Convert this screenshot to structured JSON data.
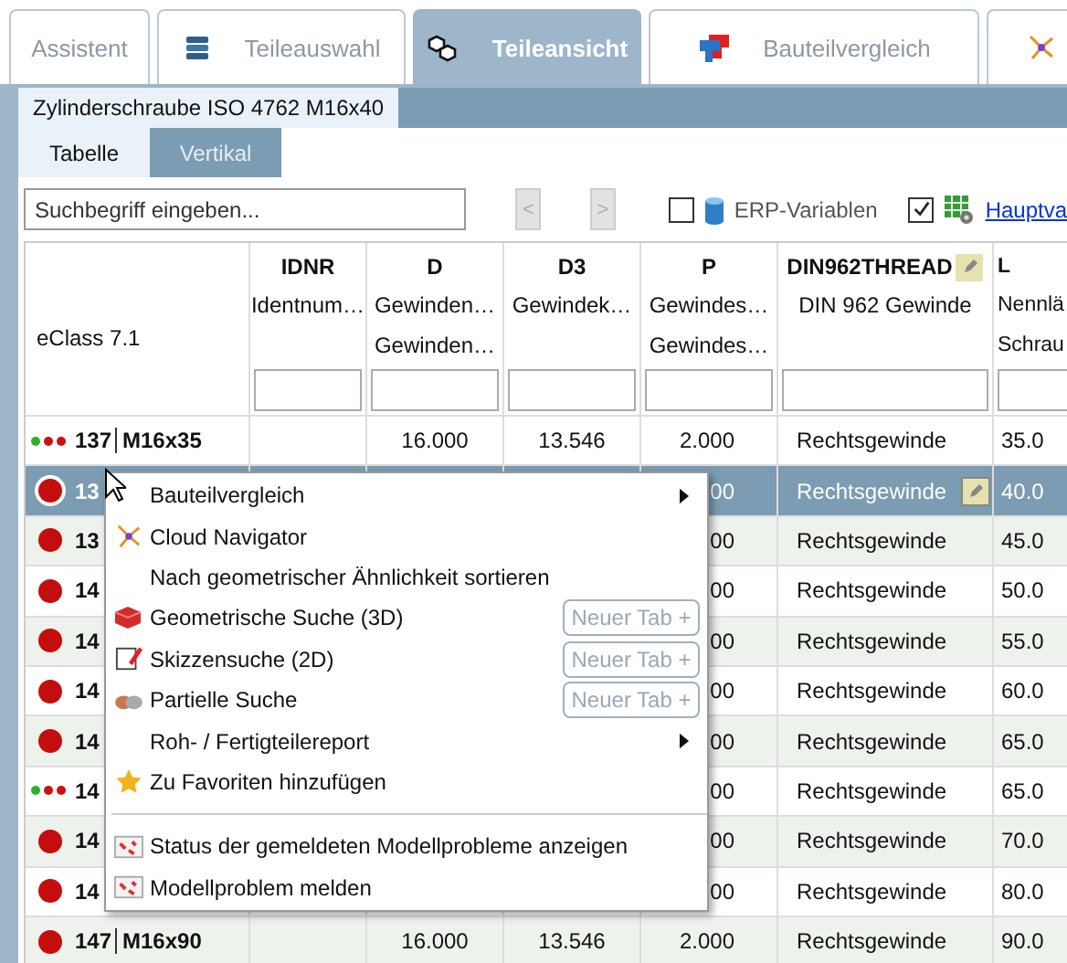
{
  "tabs": [
    {
      "label": "Assistent",
      "selected": false
    },
    {
      "label": "Teileauswahl",
      "selected": false
    },
    {
      "label": "Teileansicht",
      "selected": true
    },
    {
      "label": "Bauteilvergleich",
      "selected": false
    },
    {
      "selected": false
    }
  ],
  "document_tab": "Zylinderschraube ISO 4762 M16x40",
  "view_tabs": [
    {
      "label": "Tabelle",
      "selected": true
    },
    {
      "label": "Vertikal",
      "selected": false
    }
  ],
  "toolbar": {
    "search": {
      "placeholder": "Suchbegriff eingeben..."
    },
    "prev": "<",
    "next": ">",
    "options": [
      {
        "label": "ERP-Variablen",
        "checked": false,
        "link": false
      },
      {
        "label": "Hauptva",
        "checked": true,
        "link": true
      }
    ]
  },
  "table": {
    "corner": "eClass 7.1",
    "columns": [
      {
        "name": "IDNR",
        "desc": [
          "Identnum…"
        ],
        "editable": false
      },
      {
        "name": "D",
        "desc": [
          "Gewinden…",
          "Gewinden…"
        ],
        "editable": false
      },
      {
        "name": "D3",
        "desc": [
          "Gewindek…"
        ],
        "editable": false
      },
      {
        "name": "P",
        "desc": [
          "Gewindes…",
          "Gewindes…"
        ],
        "editable": false
      },
      {
        "name": "DIN962THREAD",
        "desc": [
          "DIN 962 Gewinde"
        ],
        "editable": true
      },
      {
        "name": "L",
        "desc": [
          "Nennlä",
          "Schrau"
        ],
        "editable": false
      }
    ],
    "rows": [
      {
        "kind": "dots",
        "dots": [
          {
            "color": "#2bb02b"
          },
          {
            "color": "#cc1111"
          },
          {
            "color": "#cc1111"
          }
        ],
        "number": "137",
        "name": "M16x35",
        "d": "16.000",
        "d3": "13.546",
        "p": "2.000",
        "thread": "Rechtsgewinde",
        "l": "35.0",
        "selected": false
      },
      {
        "kind": "circle",
        "color": "#c40d0d",
        "number": "13",
        "p": "00",
        "thread": "Rechtsgewinde",
        "l": "40.0",
        "selected": true
      },
      {
        "kind": "circle",
        "color": "#c40d0d",
        "number": "13",
        "p": "00",
        "thread": "Rechtsgewinde",
        "l": "45.0",
        "selected": false
      },
      {
        "kind": "circle",
        "color": "#c40d0d",
        "number": "14",
        "p": "00",
        "thread": "Rechtsgewinde",
        "l": "50.0",
        "selected": false
      },
      {
        "kind": "circle",
        "color": "#c40d0d",
        "number": "14",
        "p": "00",
        "thread": "Rechtsgewinde",
        "l": "55.0",
        "selected": false
      },
      {
        "kind": "circle",
        "color": "#c40d0d",
        "number": "14",
        "p": "00",
        "thread": "Rechtsgewinde",
        "l": "60.0",
        "selected": false
      },
      {
        "kind": "circle",
        "color": "#c40d0d",
        "number": "14",
        "p": "00",
        "thread": "Rechtsgewinde",
        "l": "65.0",
        "selected": false
      },
      {
        "kind": "dots",
        "dots": [
          {
            "color": "#2bb02b"
          },
          {
            "color": "#cc1111"
          },
          {
            "color": "#cc1111"
          }
        ],
        "number": "14",
        "p": "00",
        "thread": "Rechtsgewinde",
        "l": "65.0",
        "selected": false
      },
      {
        "kind": "circle",
        "color": "#c40d0d",
        "number": "14",
        "p": "00",
        "thread": "Rechtsgewinde",
        "l": "70.0",
        "selected": false
      },
      {
        "kind": "circle",
        "color": "#c40d0d",
        "number": "14",
        "p": "00",
        "thread": "Rechtsgewinde",
        "l": "80.0",
        "selected": false
      },
      {
        "kind": "circle",
        "color": "#c40d0d",
        "number": "147",
        "name": "M16x90",
        "d": "16.000",
        "d3": "13.546",
        "p": "2.000",
        "thread": "Rechtsgewinde",
        "l": "90.0",
        "selected": false
      }
    ]
  },
  "context_menu": {
    "items": [
      {
        "kind": "item",
        "label": "Bauteilvergleich",
        "submenu": true
      },
      {
        "kind": "item",
        "label": "Cloud Navigator",
        "submenu": false
      },
      {
        "kind": "item",
        "label": "Nach geometrischer Ähnlichkeit sortieren",
        "submenu": false
      },
      {
        "kind": "item",
        "label": "Geometrische Suche (3D)",
        "submenu": false,
        "button": "Neuer Tab +"
      },
      {
        "kind": "item",
        "label": "Skizzensuche (2D)",
        "submenu": false,
        "button": "Neuer Tab +"
      },
      {
        "kind": "item",
        "label": "Partielle Suche",
        "submenu": false,
        "button": "Neuer Tab +"
      },
      {
        "kind": "item",
        "label": "Roh- / Fertigteilereport",
        "submenu": true
      },
      {
        "kind": "item",
        "label": "Zu Favoriten hinzufügen",
        "submenu": false
      },
      {
        "kind": "separator"
      },
      {
        "kind": "item",
        "label": "Status der gemeldeten Modellprobleme anzeigen",
        "submenu": false
      },
      {
        "kind": "item",
        "label": "Modellproblem melden",
        "submenu": false
      }
    ]
  }
}
